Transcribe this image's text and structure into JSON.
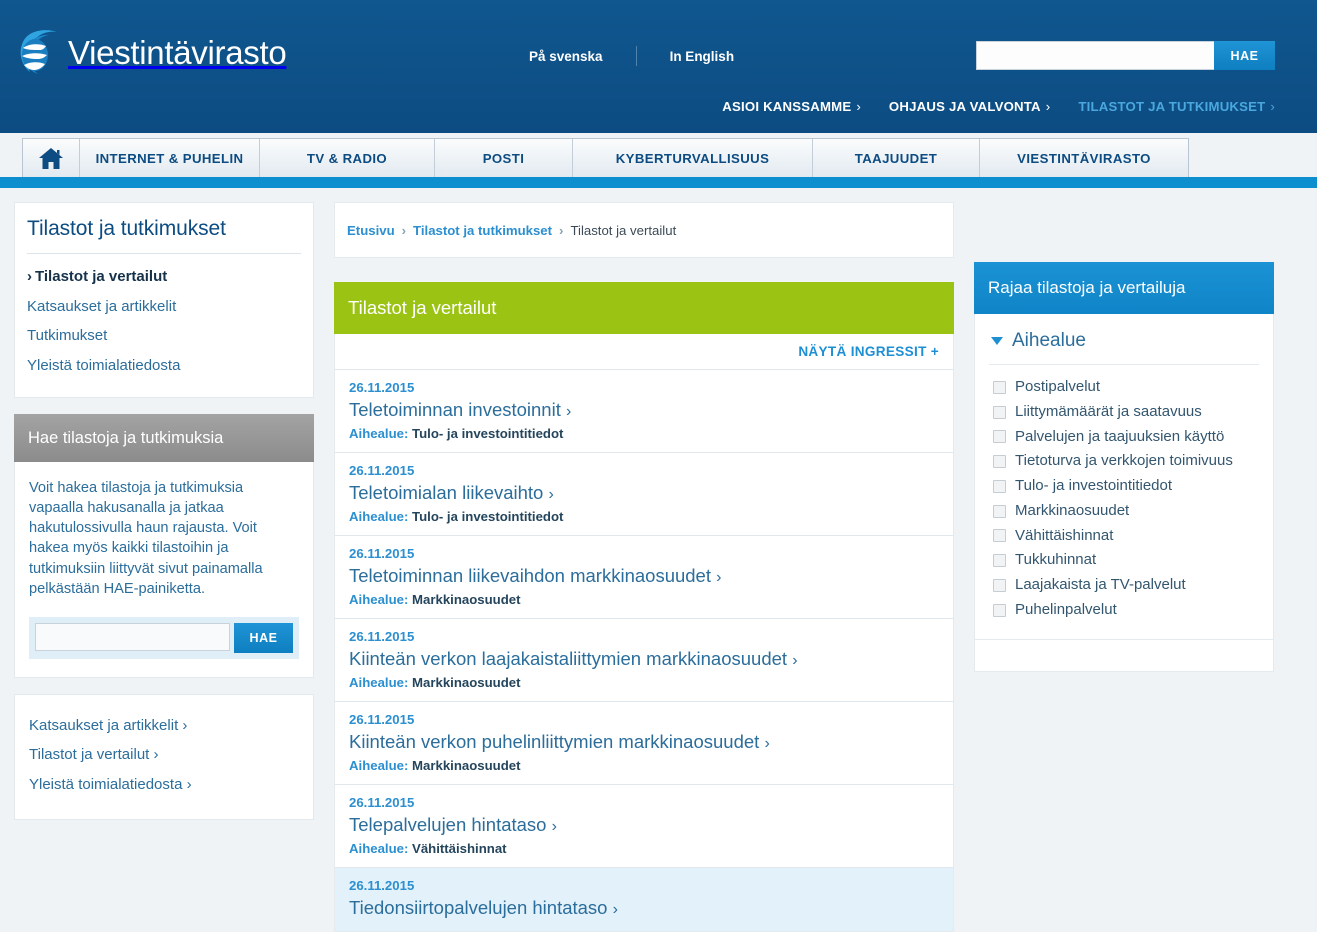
{
  "header": {
    "logo_text": "Viestintävirasto",
    "logo_icon": "globe-leaf-logo-icon",
    "lang_links": [
      {
        "label": "På svenska"
      },
      {
        "label": "In English"
      }
    ],
    "search": {
      "value": "",
      "placeholder": "",
      "button_label": "HAE"
    },
    "section_nav": [
      {
        "label": "ASIOI KANSSAMME",
        "caret": "›",
        "active": false
      },
      {
        "label": "OHJAUS JA VALVONTA",
        "caret": "›",
        "active": false
      },
      {
        "label": "TILASTOT JA TUTKIMUKSET",
        "caret": "›",
        "active": true
      }
    ],
    "main_tabs": [
      {
        "label": "",
        "icon": "home-icon"
      },
      {
        "label": "INTERNET & PUHELIN"
      },
      {
        "label": "TV & RADIO"
      },
      {
        "label": "POSTI"
      },
      {
        "label": "KYBERTURVALLISUUS"
      },
      {
        "label": "TAAJUUDET"
      },
      {
        "label": "VIESTINTÄVIRASTO"
      }
    ]
  },
  "sidebar": {
    "title": "Tilastot ja tutkimukset",
    "items": [
      {
        "label": "Tilastot ja vertailut",
        "current": true
      },
      {
        "label": "Katsaukset ja artikkelit",
        "current": false
      },
      {
        "label": "Tutkimukset",
        "current": false
      },
      {
        "label": "Yleistä toimialatiedosta",
        "current": false
      }
    ],
    "searchbox": {
      "title": "Hae tilastoja ja tutkimuksia",
      "description": "Voit hakea tilastoja ja tutkimuksia vapaalla hakusanalla ja jatkaa hakutulossivulla haun rajausta. Voit hakea myös kaikki tilastoihin ja tutkimuksiin liittyvät sivut painamalla pelkästään HAE-painiketta.",
      "input_value": "",
      "input_placeholder": "",
      "button_label": "HAE"
    },
    "quicklinks": [
      {
        "label": "Katsaukset ja artikkelit",
        "caret": "›"
      },
      {
        "label": "Tilastot ja vertailut",
        "caret": "›"
      },
      {
        "label": "Yleistä toimialatiedosta",
        "caret": "›"
      }
    ]
  },
  "breadcrumb": {
    "items": [
      {
        "label": "Etusivu",
        "link": true
      },
      {
        "label": "Tilastot ja tutkimukset",
        "link": true
      },
      {
        "label": "Tilastot ja vertailut",
        "link": false
      }
    ],
    "separator": "›"
  },
  "main": {
    "banner_title": "Tilastot ja vertailut",
    "ingress_toggle": "NÄYTÄ INGRESSIT +",
    "meta_label": "Aihealue:",
    "results": [
      {
        "date": "26.11.2015",
        "title": "Teletoiminnan investoinnit",
        "caret": "›",
        "topic": "Tulo- ja investointitiedot",
        "highlighted": false
      },
      {
        "date": "26.11.2015",
        "title": "Teletoimialan liikevaihto",
        "caret": "›",
        "topic": "Tulo- ja investointitiedot",
        "highlighted": false
      },
      {
        "date": "26.11.2015",
        "title": "Teletoiminnan liikevaihdon markkinaosuudet",
        "caret": "›",
        "topic": "Markkinaosuudet",
        "highlighted": false
      },
      {
        "date": "26.11.2015",
        "title": "Kiinteän verkon laajakaistaliittymien markkinaosuudet",
        "caret": "›",
        "topic": "Markkinaosuudet",
        "highlighted": false
      },
      {
        "date": "26.11.2015",
        "title": "Kiinteän verkon puhelinliittymien markkinaosuudet",
        "caret": "›",
        "topic": "Markkinaosuudet",
        "highlighted": false
      },
      {
        "date": "26.11.2015",
        "title": "Telepalvelujen hintataso",
        "caret": "›",
        "topic": "Vähittäishinnat",
        "highlighted": false
      },
      {
        "date": "26.11.2015",
        "title": "Tiedonsiirtopalvelujen hintataso",
        "caret": "›",
        "topic": "",
        "highlighted": true
      }
    ]
  },
  "filters": {
    "title": "Rajaa tilastoja ja vertailuja",
    "group_title": "Aihealue",
    "group_expanded": true,
    "options": [
      {
        "label": "Postipalvelut",
        "checked": false
      },
      {
        "label": "Liittymämäärät ja saatavuus",
        "checked": false
      },
      {
        "label": "Palvelujen ja taajuuksien käyttö",
        "checked": false
      },
      {
        "label": "Tietoturva ja verkkojen toimivuus",
        "checked": false
      },
      {
        "label": "Tulo- ja investointitiedot",
        "checked": false
      },
      {
        "label": "Markkinaosuudet",
        "checked": false
      },
      {
        "label": "Vähittäishinnat",
        "checked": false
      },
      {
        "label": "Tukkuhinnat",
        "checked": false
      },
      {
        "label": "Laajakaista ja TV-palvelut",
        "checked": false
      },
      {
        "label": "Puhelinpalvelut",
        "checked": false
      }
    ]
  },
  "colors": {
    "header_blue": "#0d4f87",
    "accent_blue": "#0d8ecf",
    "link_blue": "#2b8fd0",
    "banner_green": "#9bc314",
    "filter_blue": "#1389cf",
    "page_bg": "#eff3f6",
    "gray_header": "#8c8c8c",
    "highlight_row": "#e2f1fa"
  }
}
